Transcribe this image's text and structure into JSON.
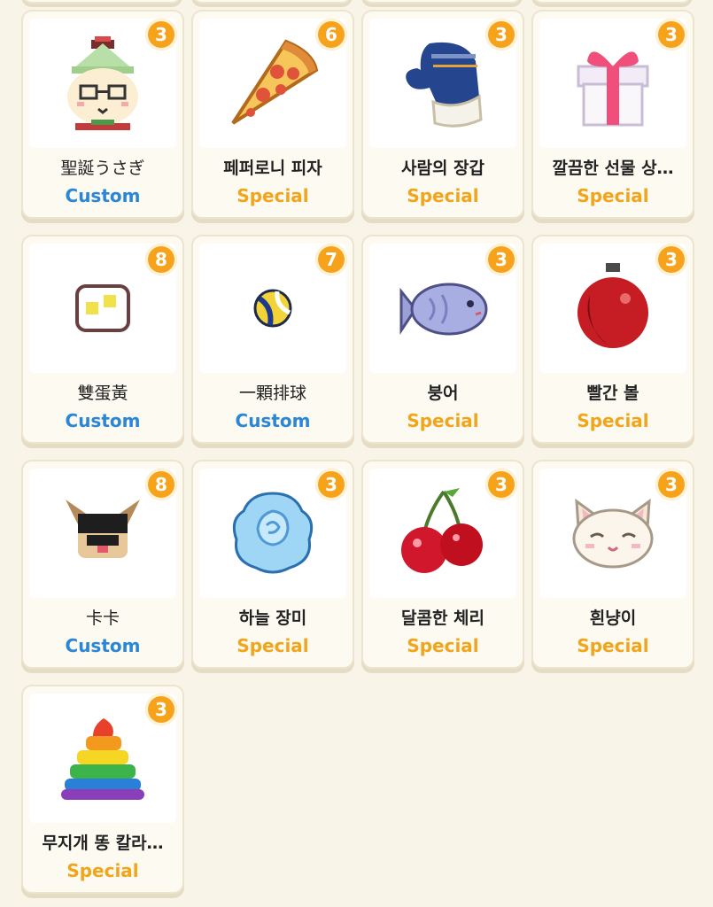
{
  "colors": {
    "badge": "#f7a21b",
    "custom": "#2a86d6",
    "special": "#f2a51a",
    "background": "#f8f4e8"
  },
  "items": [
    {
      "name": "聖誕うさぎ",
      "type": "Custom",
      "count": "3",
      "icon": "christmas-rabbit-icon"
    },
    {
      "name": "페퍼로니 피자",
      "type": "Special",
      "count": "6",
      "icon": "pizza-icon"
    },
    {
      "name": "사람의 장갑",
      "type": "Special",
      "count": "3",
      "icon": "mitten-icon"
    },
    {
      "name": "깔끔한 선물 상…",
      "type": "Special",
      "count": "3",
      "icon": "gift-box-icon"
    },
    {
      "name": "雙蛋黃",
      "type": "Custom",
      "count": "8",
      "icon": "double-yolk-icon"
    },
    {
      "name": "一顆排球",
      "type": "Custom",
      "count": "7",
      "icon": "volleyball-icon"
    },
    {
      "name": "붕어",
      "type": "Special",
      "count": "3",
      "icon": "fish-bread-icon"
    },
    {
      "name": "빨간 볼",
      "type": "Special",
      "count": "3",
      "icon": "red-ornament-icon"
    },
    {
      "name": "卡卡",
      "type": "Custom",
      "count": "8",
      "icon": "dog-icon"
    },
    {
      "name": "하늘 장미",
      "type": "Special",
      "count": "3",
      "icon": "blue-rose-icon"
    },
    {
      "name": "달콤한 체리",
      "type": "Special",
      "count": "3",
      "icon": "cherry-icon"
    },
    {
      "name": "흰냥이",
      "type": "Special",
      "count": "3",
      "icon": "white-cat-icon"
    },
    {
      "name": "무지개 똥 칼라…",
      "type": "Special",
      "count": "3",
      "icon": "rainbow-poop-icon"
    }
  ]
}
